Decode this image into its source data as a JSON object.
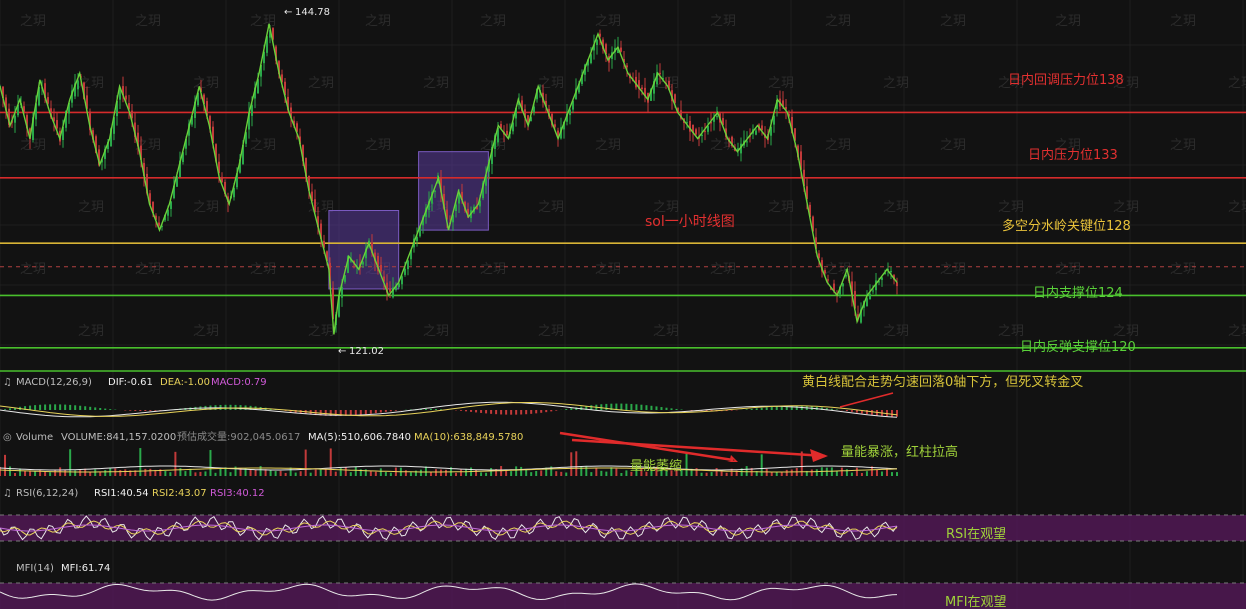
{
  "chart_data": {
    "type": "candlestick",
    "title": "sol一小时线图",
    "price_extremes": {
      "high": "144.78",
      "low": "121.02"
    },
    "price_levels": [
      {
        "label": "日内回调压力位138",
        "value": 138,
        "color": "#d62b2b"
      },
      {
        "label": "日内压力位133",
        "value": 133,
        "color": "#d62b2b"
      },
      {
        "label": "多空分水岭关键位128",
        "value": 128,
        "color": "#d8b436"
      },
      {
        "label": "日内支撑位124",
        "value": 124,
        "color": "#49c02c"
      },
      {
        "label": "日内反弹支撑位120",
        "value": 120,
        "color": "#49c02c"
      }
    ],
    "close_path": [
      [
        0,
        140
      ],
      [
        2,
        137
      ],
      [
        4,
        139
      ],
      [
        6,
        136
      ],
      [
        8,
        140.5
      ],
      [
        10,
        138
      ],
      [
        12,
        136
      ],
      [
        14,
        139
      ],
      [
        16,
        141
      ],
      [
        18,
        137
      ],
      [
        20,
        134
      ],
      [
        22,
        136
      ],
      [
        24,
        140
      ],
      [
        26,
        138
      ],
      [
        28,
        135
      ],
      [
        30,
        131
      ],
      [
        32,
        129
      ],
      [
        34,
        131
      ],
      [
        36,
        134
      ],
      [
        38,
        137
      ],
      [
        40,
        140
      ],
      [
        42,
        137
      ],
      [
        44,
        133
      ],
      [
        46,
        131
      ],
      [
        48,
        134
      ],
      [
        50,
        138
      ],
      [
        52,
        141
      ],
      [
        54,
        144.78
      ],
      [
        56,
        141
      ],
      [
        58,
        138
      ],
      [
        60,
        136
      ],
      [
        62,
        132
      ],
      [
        64,
        129
      ],
      [
        66,
        126
      ],
      [
        67,
        121.02
      ],
      [
        68,
        124
      ],
      [
        70,
        127
      ],
      [
        72,
        126
      ],
      [
        74,
        128
      ],
      [
        76,
        126
      ],
      [
        78,
        124
      ],
      [
        80,
        125
      ],
      [
        82,
        127
      ],
      [
        84,
        129
      ],
      [
        86,
        131
      ],
      [
        88,
        133
      ],
      [
        90,
        129
      ],
      [
        92,
        132
      ],
      [
        94,
        130
      ],
      [
        96,
        131
      ],
      [
        98,
        134
      ],
      [
        100,
        137
      ],
      [
        102,
        136
      ],
      [
        104,
        139
      ],
      [
        106,
        137
      ],
      [
        108,
        140
      ],
      [
        110,
        138
      ],
      [
        112,
        136
      ],
      [
        114,
        138
      ],
      [
        116,
        140
      ],
      [
        118,
        142
      ],
      [
        120,
        144
      ],
      [
        122,
        142
      ],
      [
        124,
        143
      ],
      [
        126,
        141
      ],
      [
        128,
        140
      ],
      [
        130,
        139
      ],
      [
        132,
        141
      ],
      [
        134,
        140
      ],
      [
        136,
        138
      ],
      [
        138,
        137
      ],
      [
        140,
        136
      ],
      [
        142,
        137
      ],
      [
        144,
        138
      ],
      [
        146,
        136
      ],
      [
        148,
        135
      ],
      [
        150,
        136
      ],
      [
        152,
        137
      ],
      [
        154,
        136
      ],
      [
        156,
        139
      ],
      [
        158,
        138
      ],
      [
        160,
        135
      ],
      [
        162,
        131
      ],
      [
        164,
        127
      ],
      [
        166,
        125
      ],
      [
        168,
        124
      ],
      [
        170,
        126
      ],
      [
        172,
        122
      ],
      [
        174,
        124
      ],
      [
        176,
        125
      ],
      [
        178,
        126
      ],
      [
        180,
        125
      ]
    ],
    "consolidation_boxes": [
      {
        "from": 66,
        "to": 80,
        "high": 130.5,
        "low": 124.5
      },
      {
        "from": 84,
        "to": 98,
        "high": 135,
        "low": 129
      }
    ],
    "y_range": [
      118.3,
      146.6
    ],
    "annotation": "",
    "grid": true,
    "indicators": {
      "macd": {
        "label": "MACD(12,26,9)",
        "dif": "DIF:-0.61",
        "dea": "DEA:-1.00",
        "macd": "MACD:0.79",
        "note": "黄白线配合走势匀速回落0轴下方，但死叉转金叉"
      },
      "volume": {
        "label": "Volume",
        "volume": "VOLUME:841,157.0200",
        "est": "预估成交量:902,045.0617",
        "ma5": "MA(5):510,606.7840",
        "ma10": "MA(10):638,849.5780",
        "note_shrink": "量能萎缩",
        "note_surge": "量能暴涨，红柱拉高"
      },
      "rsi": {
        "label": "RSI(6,12,24)",
        "rsi1": "RSI1:40.54",
        "rsi2": "RSI2:43.07",
        "rsi3": "RSI3:40.12",
        "note": "RSI在观望"
      },
      "mfi": {
        "label": "MFI(14)",
        "mfi": "MFI:61.74",
        "note": "MFI在观望"
      }
    }
  },
  "watermark": "之玥",
  "colors": {
    "up": "#2aa84a",
    "down": "#c23a3a",
    "yellow": "#e8d25a",
    "white": "#e8e8e8",
    "purple": "#c06bd8",
    "box": "#5a3a9a",
    "band": "#5a1a5e",
    "note_green": "#9fd13a",
    "arrow": "#e02b2b"
  }
}
